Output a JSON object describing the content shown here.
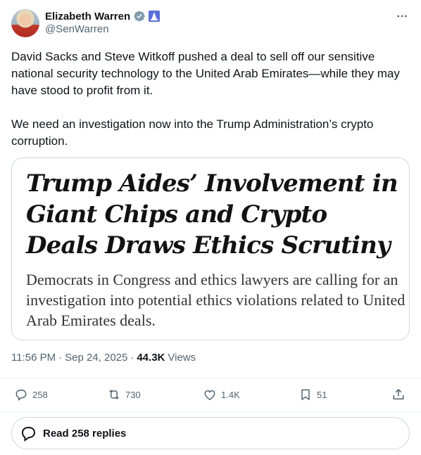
{
  "author": {
    "name": "Elizabeth Warren",
    "handle": "@SenWarren"
  },
  "tweet": {
    "paragraphs": [
      "David Sacks and Steve Witkoff pushed a deal to sell off our sensitive national security technology to the United Arab Emirates—while they may have stood to profit from it.",
      "We need an investigation now into the Trump Administration’s crypto corruption."
    ]
  },
  "card": {
    "headline": "Trump Aides’ Involvement in Giant Chips and Crypto Deals Draws Ethics Scrutiny",
    "dek": "Democrats in Congress and ethics lawyers are calling for an investigation into potential ethics violations related to United Arab Emirates deals."
  },
  "meta": {
    "time": "11:56 PM",
    "dot1": "·",
    "date": "Sep 24, 2025",
    "dot2": "·",
    "views_count": "44.3K",
    "views_label": "Views"
  },
  "actions": {
    "replies": "258",
    "reposts": "730",
    "likes": "1.4K",
    "bookmarks": "51"
  },
  "read_replies": {
    "label": "Read 258 replies"
  },
  "colors": {
    "text": "#0f1419",
    "secondary": "#536471",
    "border": "#cfd9de",
    "verified_badge": "#829aab"
  },
  "icons": [
    "verified-badge-icon",
    "flag-emoji-icon",
    "more-icon",
    "reply-icon",
    "repost-icon",
    "like-icon",
    "bookmark-icon",
    "share-icon",
    "replies-bubble-icon"
  ]
}
